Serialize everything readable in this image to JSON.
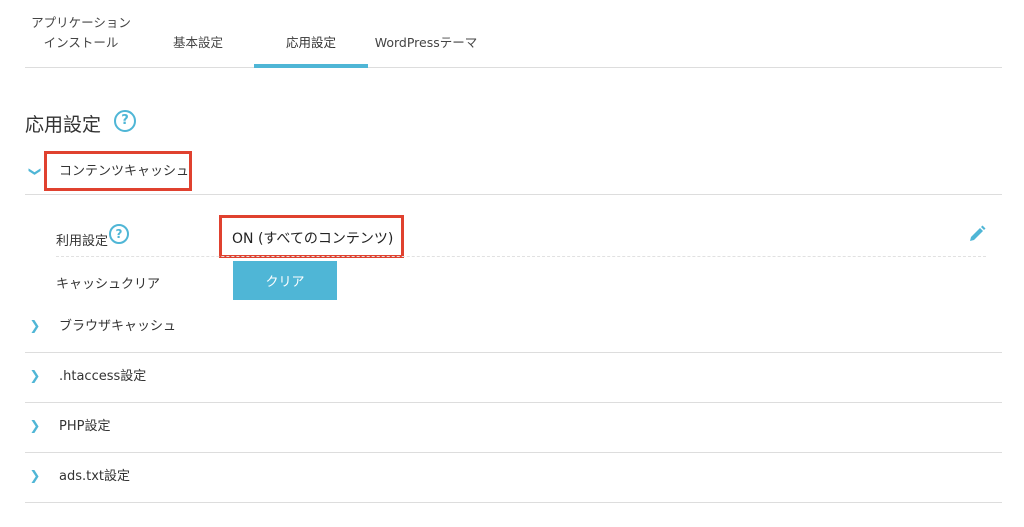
{
  "tabs": [
    {
      "label": "アプリケーション\nインストール",
      "active": false
    },
    {
      "label": "基本設定",
      "active": false
    },
    {
      "label": "応用設定",
      "active": true
    },
    {
      "label": "WordPressテーマ",
      "active": false
    }
  ],
  "page_title": "応用設定",
  "sections": {
    "content_cache": {
      "title": "コンテンツキャッシュ",
      "usage_label": "利用設定",
      "usage_value": "ON (すべてのコンテンツ)",
      "cache_clear_label": "キャッシュクリア",
      "clear_button": "クリア"
    },
    "collapsed": [
      {
        "title": "ブラウザキャッシュ"
      },
      {
        "title": ".htaccess設定"
      },
      {
        "title": "PHP設定"
      },
      {
        "title": "ads.txt設定"
      }
    ]
  },
  "icons": {
    "help": "?",
    "chevron_right": "❯",
    "chevron_down": "❯"
  },
  "colors": {
    "accent": "#4fb6d6",
    "highlight": "#e0412f"
  }
}
